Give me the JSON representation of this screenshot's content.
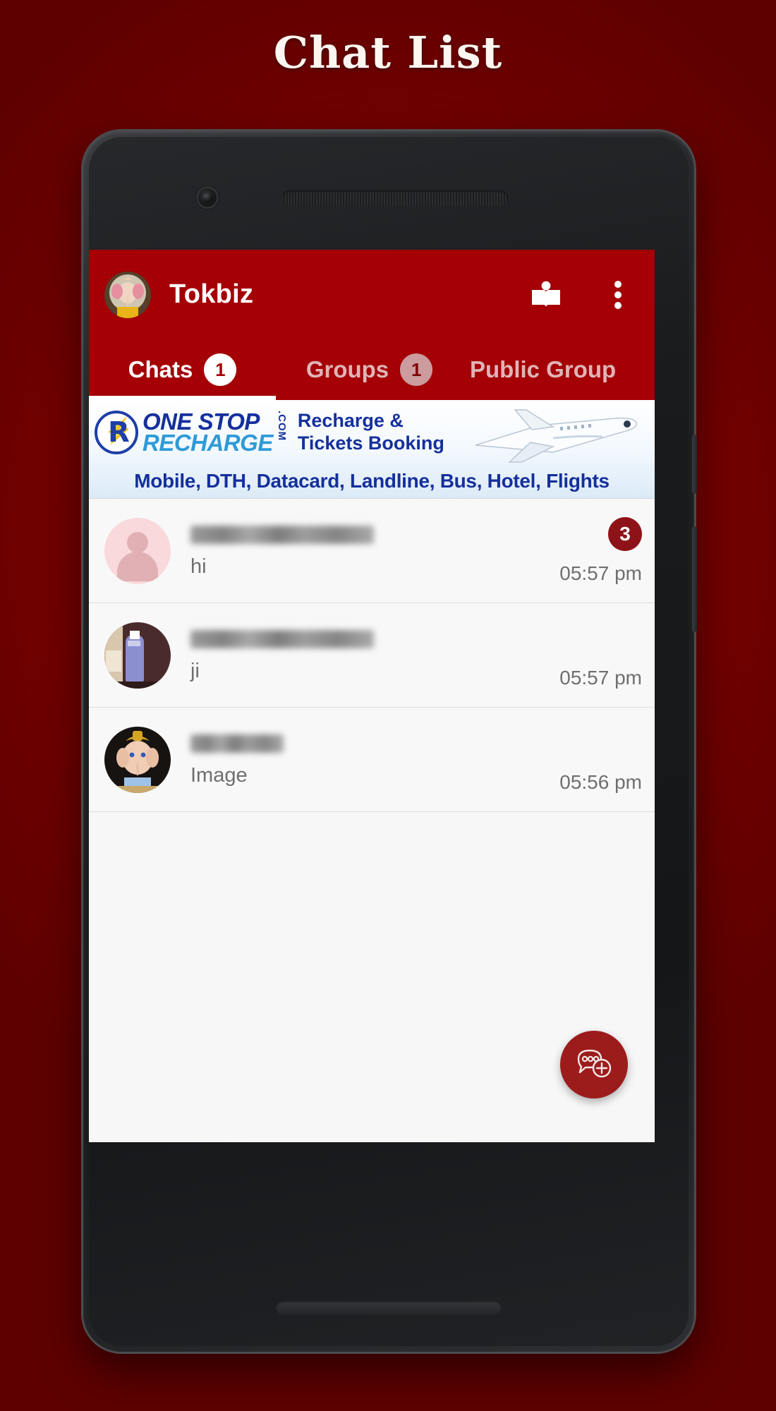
{
  "page": {
    "title": "Chat List",
    "background_color": "#7a0000"
  },
  "app": {
    "accent_color": "#a40005",
    "header": {
      "title": "Tokbiz",
      "avatar_icon": "ganesha-avatar",
      "actions": [
        {
          "icon": "book-reader-icon",
          "label": "Stories"
        },
        {
          "icon": "overflow-menu-icon",
          "label": "More options"
        }
      ]
    },
    "tabs": [
      {
        "label": "Chats",
        "badge": "1",
        "active": true
      },
      {
        "label": "Groups",
        "badge": "1",
        "active": false
      },
      {
        "label": "Public Group",
        "badge": "",
        "active": false
      }
    ],
    "banner": {
      "brand_line1": "ONE STOP",
      "brand_line2": "RECHARGE",
      "brand_suffix": ".COM",
      "headline_line1": "Recharge &",
      "headline_line2": "Tickets Booking",
      "services": "Mobile, DTH, Datacard, Landline, Bus, Hotel, Flights",
      "artwork_icon": "airplane-icon"
    },
    "chats": [
      {
        "name_redacted": true,
        "name_width": 260,
        "message": "hi",
        "time": "05:57 pm",
        "unread": "3",
        "avatar_type": "placeholder"
      },
      {
        "name_redacted": true,
        "name_width": 260,
        "message": "ji",
        "time": "05:57 pm",
        "unread": "",
        "avatar_type": "bottle-photo"
      },
      {
        "name_redacted": true,
        "name_width": 132,
        "message": "Image",
        "time": "05:56 pm",
        "unread": "",
        "avatar_type": "ganesha-photo"
      }
    ],
    "fab": {
      "icon": "new-chat-icon",
      "label": "New chat",
      "color": "#9c1c1c"
    }
  }
}
